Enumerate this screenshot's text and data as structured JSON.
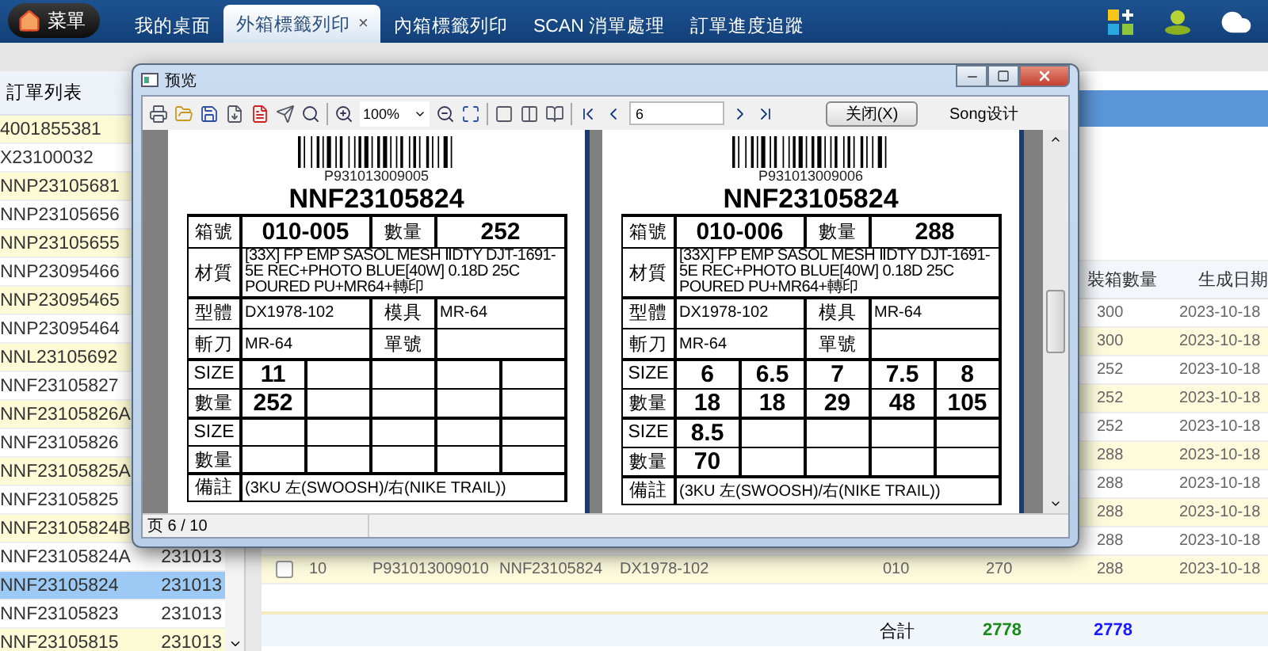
{
  "menu_button": "菜單",
  "tabs": [
    {
      "label": "我的桌面",
      "selected": false
    },
    {
      "label": "外箱標籤列印",
      "selected": true,
      "close": "×"
    },
    {
      "label": "內箱標籤列印",
      "selected": false
    },
    {
      "label": "SCAN 消單處理",
      "selected": false
    },
    {
      "label": "訂單進度追蹤",
      "selected": false
    }
  ],
  "order_list": {
    "title": "訂單列表",
    "rows": [
      {
        "order": "4001855381",
        "selected": false
      },
      {
        "order": "X23100032",
        "selected": false
      },
      {
        "order": "NNP23105681",
        "selected": false
      },
      {
        "order": "NNP23105656",
        "selected": false
      },
      {
        "order": "NNP23105655",
        "selected": false
      },
      {
        "order": "NNP23095466",
        "selected": false
      },
      {
        "order": "NNP23095465",
        "selected": false
      },
      {
        "order": "NNP23095464",
        "selected": false
      },
      {
        "order": "NNL23105692",
        "selected": false
      },
      {
        "order": "NNF23105827",
        "selected": false
      },
      {
        "order": "NNF23105826A",
        "selected": false
      },
      {
        "order": "NNF23105826",
        "selected": false
      },
      {
        "order": "NNF23105825A",
        "selected": false
      },
      {
        "order": "NNF23105825",
        "selected": false
      },
      {
        "order": "NNF23105824B",
        "selected": false
      },
      {
        "order": "NNF23105824A",
        "date": "231013",
        "selected": false
      },
      {
        "order": "NNF23105824",
        "date": "231013",
        "selected": true
      },
      {
        "order": "NNF23105823",
        "date": "231013",
        "selected": false
      },
      {
        "order": "NNF23105815",
        "date": "231013",
        "selected": false
      }
    ]
  },
  "grid": {
    "columns": {
      "qty": "裝箱數量",
      "date": "生成日期"
    },
    "rows": [
      {
        "qty": "300",
        "date": "2023-10-18"
      },
      {
        "qty": "300",
        "date": "2023-10-18"
      },
      {
        "qty": "252",
        "date": "2023-10-18"
      },
      {
        "qty": "252",
        "date": "2023-10-18"
      },
      {
        "qty": "252",
        "date": "2023-10-18"
      },
      {
        "qty": "288",
        "date": "2023-10-18"
      },
      {
        "qty": "288",
        "date": "2023-10-18"
      },
      {
        "qty": "288",
        "date": "2023-10-18"
      },
      {
        "qty": "288",
        "date": "2023-10-18"
      },
      {
        "checked": false,
        "no": "10",
        "barcode": "P931013009010",
        "order": "NNF23105824",
        "model": "DX1978-102",
        "column_5": "010",
        "column_6": "270",
        "qty": "288",
        "date": "2023-10-18"
      }
    ],
    "totals": {
      "label": "合計",
      "values": [
        {
          "text": "2778",
          "color": "#1a8a1a"
        },
        {
          "text": "2778",
          "color": "#1a1aff"
        }
      ]
    }
  },
  "preview": {
    "title": "预览",
    "zoom": "100%",
    "page": "6",
    "close_button": "关闭(X)",
    "brand": "Song设计",
    "status": "页 6 / 10",
    "labels": [
      {
        "barcode": "P931013009005",
        "title": "NNF23105824",
        "box_label": "箱號",
        "box": "010-005",
        "qty_label": "數量",
        "qty": "252",
        "material_label": "材質",
        "material": "[33X] FP EMP SASOL MESH ⅡDTY DJT-1691-5E REC+PHOTO BLUE[40W] 0.18D 25C POURED PU+MR64+轉印",
        "model_label": "型體",
        "model": "DX1978-102",
        "mold_label": "模具",
        "mold": "MR-64",
        "knife_label": "斬刀",
        "knife": "MR-64",
        "order_label": "單號",
        "size_rows": [
          {
            "label": "SIZE",
            "values": [
              "11"
            ]
          },
          {
            "label": "數量",
            "values": [
              "252"
            ]
          },
          {
            "label": "SIZE"
          },
          {
            "label": "數量"
          }
        ],
        "remark_label": "備註",
        "remark": "(3KU 左(SWOOSH)/右(NIKE TRAIL))"
      },
      {
        "barcode": "P931013009006",
        "title": "NNF23105824",
        "box_label": "箱號",
        "box": "010-006",
        "qty_label": "數量",
        "qty": "288",
        "material_label": "材質",
        "material": "[33X] FP EMP SASOL MESH ⅡDTY DJT-1691-5E REC+PHOTO BLUE[40W] 0.18D 25C POURED PU+MR64+轉印",
        "model_label": "型體",
        "model": "DX1978-102",
        "mold_label": "模具",
        "mold": "MR-64",
        "knife_label": "斬刀",
        "knife": "MR-64",
        "order_label": "單號",
        "size_rows": [
          {
            "label": "SIZE",
            "values": [
              "6",
              "6.5",
              "7",
              "7.5",
              "8"
            ]
          },
          {
            "label": "數量",
            "values": [
              "18",
              "18",
              "29",
              "48",
              "105"
            ]
          },
          {
            "label": "SIZE",
            "values": [
              "8.5"
            ]
          },
          {
            "label": "數量",
            "values": [
              "70"
            ]
          }
        ],
        "remark_label": "備註",
        "remark": "(3KU 左(SWOOSH)/右(NIKE TRAIL))"
      }
    ]
  }
}
